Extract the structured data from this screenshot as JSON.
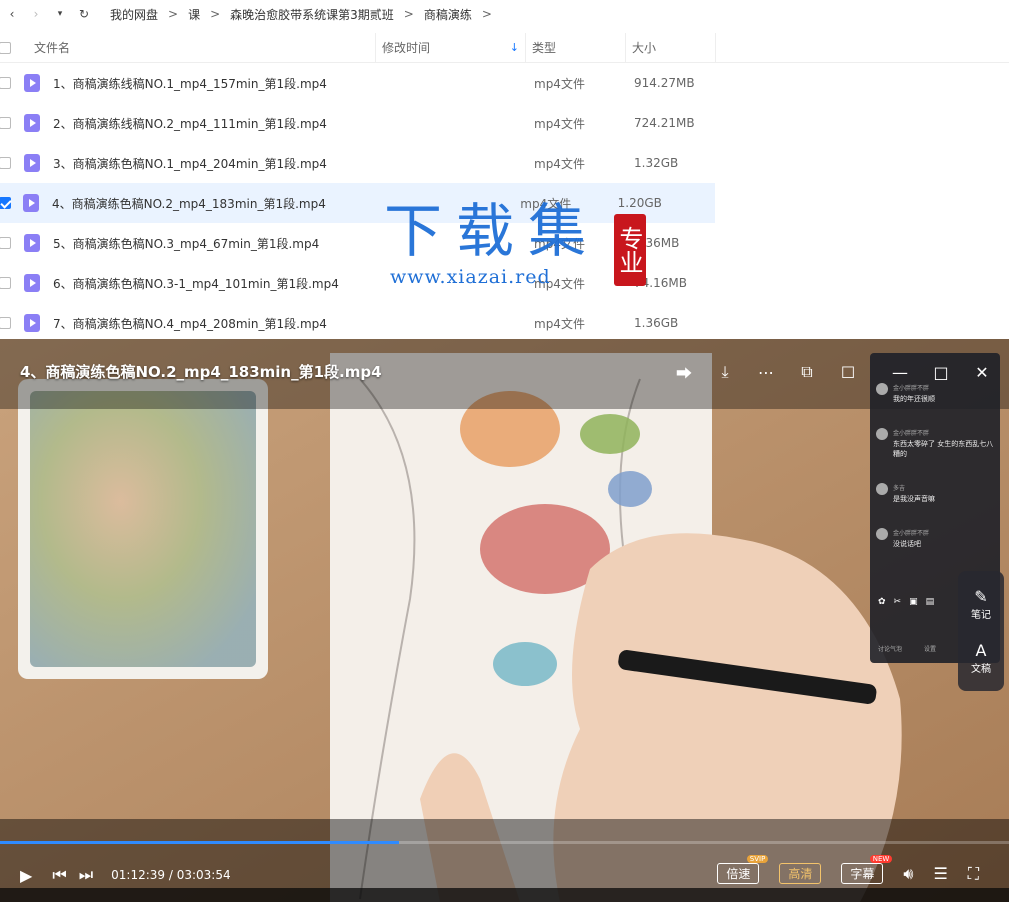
{
  "breadcrumb": {
    "items": [
      "我的网盘",
      "课",
      "森晚治愈胶带系统课第3期贰班",
      "商稿演练"
    ],
    "separator": ">"
  },
  "list_header": {
    "name": "文件名",
    "modified": "修改时间",
    "type": "类型",
    "size": "大小"
  },
  "files": [
    {
      "name": "1、商稿演练线稿NO.1_mp4_157min_第1段.mp4",
      "type": "mp4文件",
      "size": "914.27MB",
      "checked": false
    },
    {
      "name": "2、商稿演练线稿NO.2_mp4_111min_第1段.mp4",
      "type": "mp4文件",
      "size": "724.21MB",
      "checked": false
    },
    {
      "name": "3、商稿演练色稿NO.1_mp4_204min_第1段.mp4",
      "type": "mp4文件",
      "size": "1.32GB",
      "checked": false
    },
    {
      "name": "4、商稿演练色稿NO.2_mp4_183min_第1段.mp4",
      "type": "mp4文件",
      "size": "1.20GB",
      "checked": true
    },
    {
      "name": "5、商稿演练色稿NO.3_mp4_67min_第1段.mp4",
      "type": "mp4文件",
      "size": "1.36MB",
      "checked": false
    },
    {
      "name": "6、商稿演练色稿NO.3-1_mp4_101min_第1段.mp4",
      "type": "mp4文件",
      "size": "74.16MB",
      "checked": false
    },
    {
      "name": "7、商稿演练色稿NO.4_mp4_208min_第1段.mp4",
      "type": "mp4文件",
      "size": "1.36GB",
      "checked": false
    }
  ],
  "player": {
    "title": "4、商稿演练色稿NO.2_mp4_183min_第1段.mp4",
    "current_time": "01:12:39",
    "total_time": "03:03:54",
    "time_separator": " / ",
    "progress": 0.395,
    "speed_label": "倍速",
    "speed_badge": "SVIP",
    "quality_label": "高清",
    "subtitle_label": "字幕",
    "subtitle_badge": "NEW",
    "accent_color": "#2f8bff"
  },
  "chat": {
    "messages": [
      {
        "user": "金小胖胖不胖",
        "text": "我的年还很顺"
      },
      {
        "user": "金小胖胖不胖",
        "text": "东西太零碎了 女生的东西乱七八糟的"
      },
      {
        "user": "多吉",
        "text": "是我没声音嘛"
      },
      {
        "user": "金小胖胖不胖",
        "text": "没说话吧"
      }
    ],
    "footer_left": "讨论气泡",
    "footer_right": "设置"
  },
  "side_tools": {
    "notes": "笔记",
    "transcript": "文稿"
  },
  "watermark": {
    "main": "下载集",
    "url": "www.xiazai.red",
    "seal": "专业"
  },
  "icons": {
    "back": "chevron-left-icon",
    "forward": "chevron-right-icon",
    "refresh": "refresh-icon",
    "share": "share-icon",
    "download": "download-icon",
    "more": "more-icon",
    "pip": "picture-in-picture-icon",
    "crop": "crop-icon",
    "play": "play-icon",
    "prev": "previous-icon",
    "next": "next-icon",
    "volume": "volume-icon",
    "playlist": "playlist-icon",
    "fullscreen": "fullscreen-icon"
  }
}
